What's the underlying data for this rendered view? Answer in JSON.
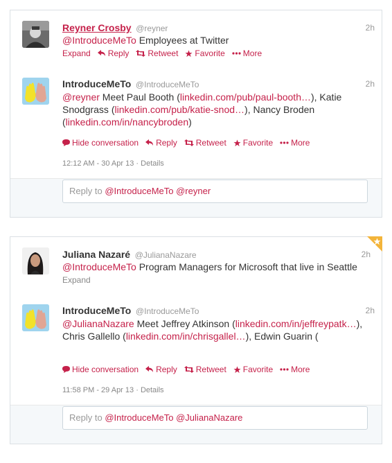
{
  "thread1": {
    "tweet": {
      "name": "Reyner Crosby",
      "handle": "@reyner",
      "time": "2h",
      "mention": "@IntroduceMeTo",
      "text": "Employees at Twitter",
      "actions": {
        "expand": "Expand",
        "reply": "Reply",
        "retweet": "Retweet",
        "favorite": "Favorite",
        "more": "More"
      }
    },
    "reply_tweet": {
      "name": "IntroduceMeTo",
      "handle": "@IntroduceMeTo",
      "time": "2h",
      "mention": "@reyner",
      "text1": " Meet Paul Booth (",
      "link1": "linkedin.com/pub/paul-booth…",
      "text2": "), Katie Snodgrass (",
      "link2": "linkedin.com/pub/katie-snod…",
      "text3": "), Nancy Broden (",
      "link3": "linkedin.com/in/nancybroden",
      "text4": ")",
      "actions": {
        "hide": "Hide conversation",
        "reply": "Reply",
        "retweet": "Retweet",
        "favorite": "Favorite",
        "more": "More"
      },
      "timestamp": "12:12 AM - 30 Apr 13",
      "details": "Details"
    },
    "reply_box": {
      "prefix": "Reply to ",
      "mentions": "@IntroduceMeTo @reyner"
    }
  },
  "thread2": {
    "tweet": {
      "name": "Juliana Nazaré",
      "handle": "@JulianaNazare",
      "time": "2h",
      "mention": "@IntroduceMeTo",
      "text": "Program Managers for Microsoft that live in Seattle",
      "actions": {
        "expand": "Expand"
      }
    },
    "reply_tweet": {
      "name": "IntroduceMeTo",
      "handle": "@IntroduceMeTo",
      "time": "2h",
      "mention": "@JulianaNazare",
      "text1": " Meet Jeffrey Atkinson (",
      "link1": "linkedin.com/in/jeffreypatk…",
      "text2": "), Chris Gallello (",
      "link2": "linkedin.com/in/chrisgallel…",
      "text3": "), Edwin Guarin (",
      "actions": {
        "hide": "Hide conversation",
        "reply": "Reply",
        "retweet": "Retweet",
        "favorite": "Favorite",
        "more": "More"
      },
      "timestamp": "11:58 PM - 29 Apr 13",
      "details": "Details"
    },
    "reply_box": {
      "prefix": "Reply to ",
      "mentions": "@IntroduceMeTo @JulianaNazare"
    }
  },
  "colors": {
    "accent": "#c5214a",
    "favorited_badge": "#f3b43a",
    "muted": "#999999"
  }
}
